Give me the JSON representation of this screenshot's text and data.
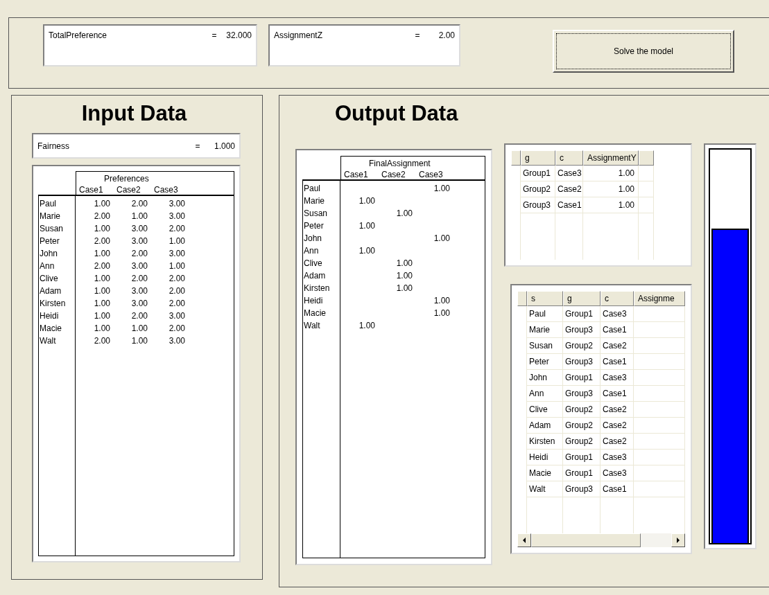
{
  "results": [
    {
      "label": "TotalPreference",
      "sign": "=",
      "value": "32.000"
    },
    {
      "label": "AssignmentZ",
      "sign": "=",
      "value": "2.00"
    }
  ],
  "solve_button": "Solve the model",
  "input_panel": {
    "title": "Input Data",
    "fairness": {
      "label": "Fairness",
      "sign": "=",
      "value": "1.000"
    },
    "preferences": {
      "title": "Preferences",
      "columns": [
        "Case1",
        "Case2",
        "Case3"
      ],
      "rows": [
        {
          "name": "Paul",
          "values": [
            "1.00",
            "2.00",
            "3.00"
          ]
        },
        {
          "name": "Marie",
          "values": [
            "2.00",
            "1.00",
            "3.00"
          ]
        },
        {
          "name": "Susan",
          "values": [
            "1.00",
            "3.00",
            "2.00"
          ]
        },
        {
          "name": "Peter",
          "values": [
            "2.00",
            "3.00",
            "1.00"
          ]
        },
        {
          "name": "John",
          "values": [
            "1.00",
            "2.00",
            "3.00"
          ]
        },
        {
          "name": "Ann",
          "values": [
            "2.00",
            "3.00",
            "1.00"
          ]
        },
        {
          "name": "Clive",
          "values": [
            "1.00",
            "2.00",
            "2.00"
          ]
        },
        {
          "name": "Adam",
          "values": [
            "1.00",
            "3.00",
            "2.00"
          ]
        },
        {
          "name": "Kirsten",
          "values": [
            "1.00",
            "3.00",
            "2.00"
          ]
        },
        {
          "name": "Heidi",
          "values": [
            "1.00",
            "2.00",
            "3.00"
          ]
        },
        {
          "name": "Macie",
          "values": [
            "1.00",
            "1.00",
            "2.00"
          ]
        },
        {
          "name": "Walt",
          "values": [
            "2.00",
            "1.00",
            "3.00"
          ]
        }
      ]
    }
  },
  "output_panel": {
    "title": "Output Data",
    "final_assignment": {
      "title": "FinalAssignment",
      "columns": [
        "Case1",
        "Case2",
        "Case3"
      ],
      "rows": [
        {
          "name": "Paul",
          "case_3": "1.00"
        },
        {
          "name": "Marie",
          "case_1": "1.00"
        },
        {
          "name": "Susan",
          "case_2": "1.00"
        },
        {
          "name": "Peter",
          "case_1": "1.00"
        },
        {
          "name": "John",
          "case_3": "1.00"
        },
        {
          "name": "Ann",
          "case_1": "1.00"
        },
        {
          "name": "Clive",
          "case_2": "1.00"
        },
        {
          "name": "Adam",
          "case_2": "1.00"
        },
        {
          "name": "Kirsten",
          "case_2": "1.00"
        },
        {
          "name": "Heidi",
          "case_3": "1.00"
        },
        {
          "name": "Macie",
          "case_3": "1.00"
        },
        {
          "name": "Walt",
          "case_1": "1.00"
        }
      ]
    },
    "assignment_y": {
      "columns": [
        "g",
        "c",
        "AssignmentY"
      ],
      "rows": [
        [
          "Group1",
          "Case3",
          "1.00"
        ],
        [
          "Group2",
          "Case2",
          "1.00"
        ],
        [
          "Group3",
          "Case1",
          "1.00"
        ]
      ]
    },
    "assignment_table": {
      "columns": [
        "s",
        "g",
        "c",
        "Assignme"
      ],
      "rows": [
        [
          "Paul",
          "Group1",
          "Case3"
        ],
        [
          "Marie",
          "Group3",
          "Case1"
        ],
        [
          "Susan",
          "Group2",
          "Case2"
        ],
        [
          "Peter",
          "Group3",
          "Case1"
        ],
        [
          "John",
          "Group1",
          "Case3"
        ],
        [
          "Ann",
          "Group3",
          "Case1"
        ],
        [
          "Clive",
          "Group2",
          "Case2"
        ],
        [
          "Adam",
          "Group2",
          "Case2"
        ],
        [
          "Kirsten",
          "Group2",
          "Case2"
        ],
        [
          "Heidi",
          "Group1",
          "Case3"
        ],
        [
          "Macie",
          "Group1",
          "Case3"
        ],
        [
          "Walt",
          "Group3",
          "Case1"
        ]
      ]
    },
    "meter": {
      "level": 0.8
    }
  }
}
